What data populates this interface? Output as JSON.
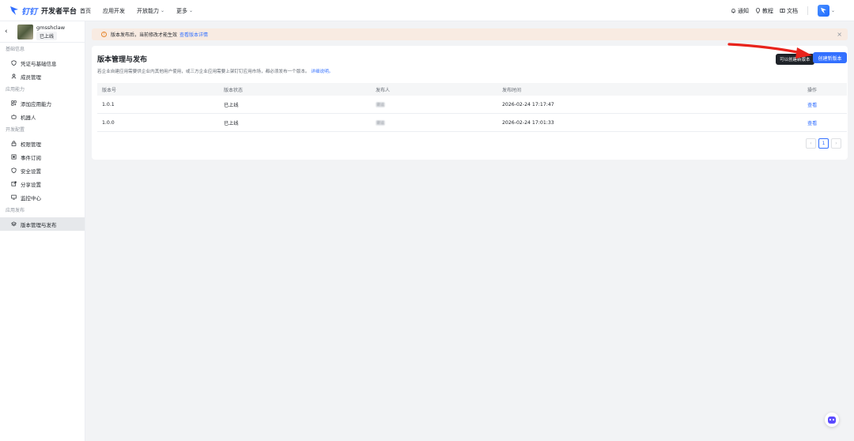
{
  "header": {
    "brand": "钉钉",
    "title": "开发者平台",
    "nav": [
      {
        "label": "首页"
      },
      {
        "label": "应用开发"
      },
      {
        "label": "开放能力"
      },
      {
        "label": "更多"
      }
    ],
    "right": {
      "notify": "通知",
      "tutorial": "教程",
      "docs": "文档"
    }
  },
  "sidebar": {
    "app_name": "gmsshclaw",
    "app_status": "已上线",
    "groups": [
      {
        "title": "基础信息",
        "items": [
          {
            "label": "凭证与基础信息"
          },
          {
            "label": "成员管理"
          }
        ]
      },
      {
        "title": "应用能力",
        "items": [
          {
            "label": "添加应用能力"
          },
          {
            "label": "机器人"
          }
        ]
      },
      {
        "title": "开发配置",
        "items": [
          {
            "label": "权限管理"
          },
          {
            "label": "事件订阅"
          },
          {
            "label": "安全设置"
          },
          {
            "label": "分享设置"
          },
          {
            "label": "监控中心"
          }
        ]
      },
      {
        "title": "应用发布",
        "items": [
          {
            "label": "版本管理与发布"
          }
        ]
      }
    ]
  },
  "alert": {
    "text": "版本发布后，当前修改才能生效",
    "link": "查看版本详情"
  },
  "page": {
    "title": "版本管理与发布",
    "desc": "若企业自建应用需要供企业内其他用户使用，或三方企业应用需要上架钉钉应用市场，都必须发布一个版本。",
    "desc_link": "详细说明。",
    "tooltip": "可以创建新版本",
    "create_button": "创建新版本"
  },
  "table": {
    "headers": [
      "版本号",
      "版本状态",
      "发布人",
      "发布时间",
      "操作"
    ],
    "rows": [
      {
        "version": "1.0.1",
        "status": "已上线",
        "publisher": "谢运",
        "time": "2026-02-24 17:17:47",
        "action": "查看"
      },
      {
        "version": "1.0.0",
        "status": "已上线",
        "publisher": "谢运",
        "time": "2026-02-24 17:01:33",
        "action": "查看"
      }
    ]
  },
  "pagination": {
    "prev": "‹",
    "current": "1",
    "next": "›"
  },
  "colors": {
    "primary": "#3370ff",
    "alert_bg": "#f8ebe2",
    "arrow": "#e8231c"
  }
}
